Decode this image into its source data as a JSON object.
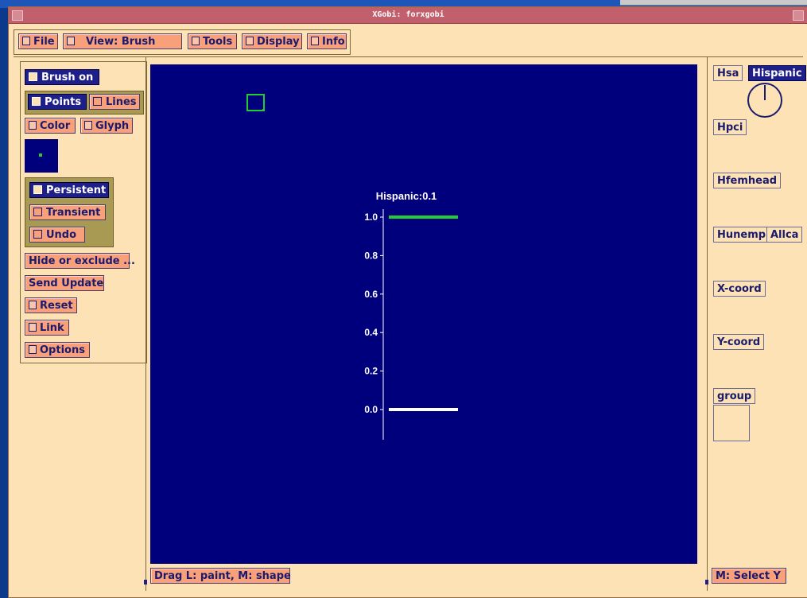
{
  "window": {
    "title": "XGobi: forxgobi"
  },
  "menubar": {
    "file": "File",
    "view": "View: Brush",
    "tools": "Tools",
    "display": "Display",
    "info": "Info"
  },
  "left_panel": {
    "brush_on": "Brush on",
    "points": "Points",
    "lines": "Lines",
    "color": "Color",
    "glyph": "Glyph",
    "persistent": "Persistent",
    "transient": "Transient",
    "undo": "Undo",
    "hide_exclude": "Hide or exclude ...",
    "send_update": "Send Update",
    "reset": "Reset",
    "link": "Link",
    "options": "Options"
  },
  "plot": {
    "label": "Hispanic:0.1",
    "ticks": [
      "1.0",
      "0.8",
      "0.6",
      "0.4",
      "0.2",
      "0.0"
    ],
    "bar_colors": {
      "top": "#22cc33",
      "bottom": "#ffffff"
    }
  },
  "variables": {
    "hsa": "Hsa",
    "hispanic": "Hispanic",
    "hpci": "Hpci",
    "hfemhead": "Hfemhead",
    "hunemp": "Hunemp",
    "allca": "Allca",
    "xcoord": "X-coord",
    "ycoord": "Y-coord",
    "group": "group"
  },
  "status": {
    "left": "Drag L: paint, M: shape",
    "right": "M: Select Y"
  },
  "colors": {
    "plot_bg": "#00007d",
    "panel_bg": "#fde2b5",
    "button_bg": "#f7a07a",
    "brush_color": "#22cc33"
  }
}
